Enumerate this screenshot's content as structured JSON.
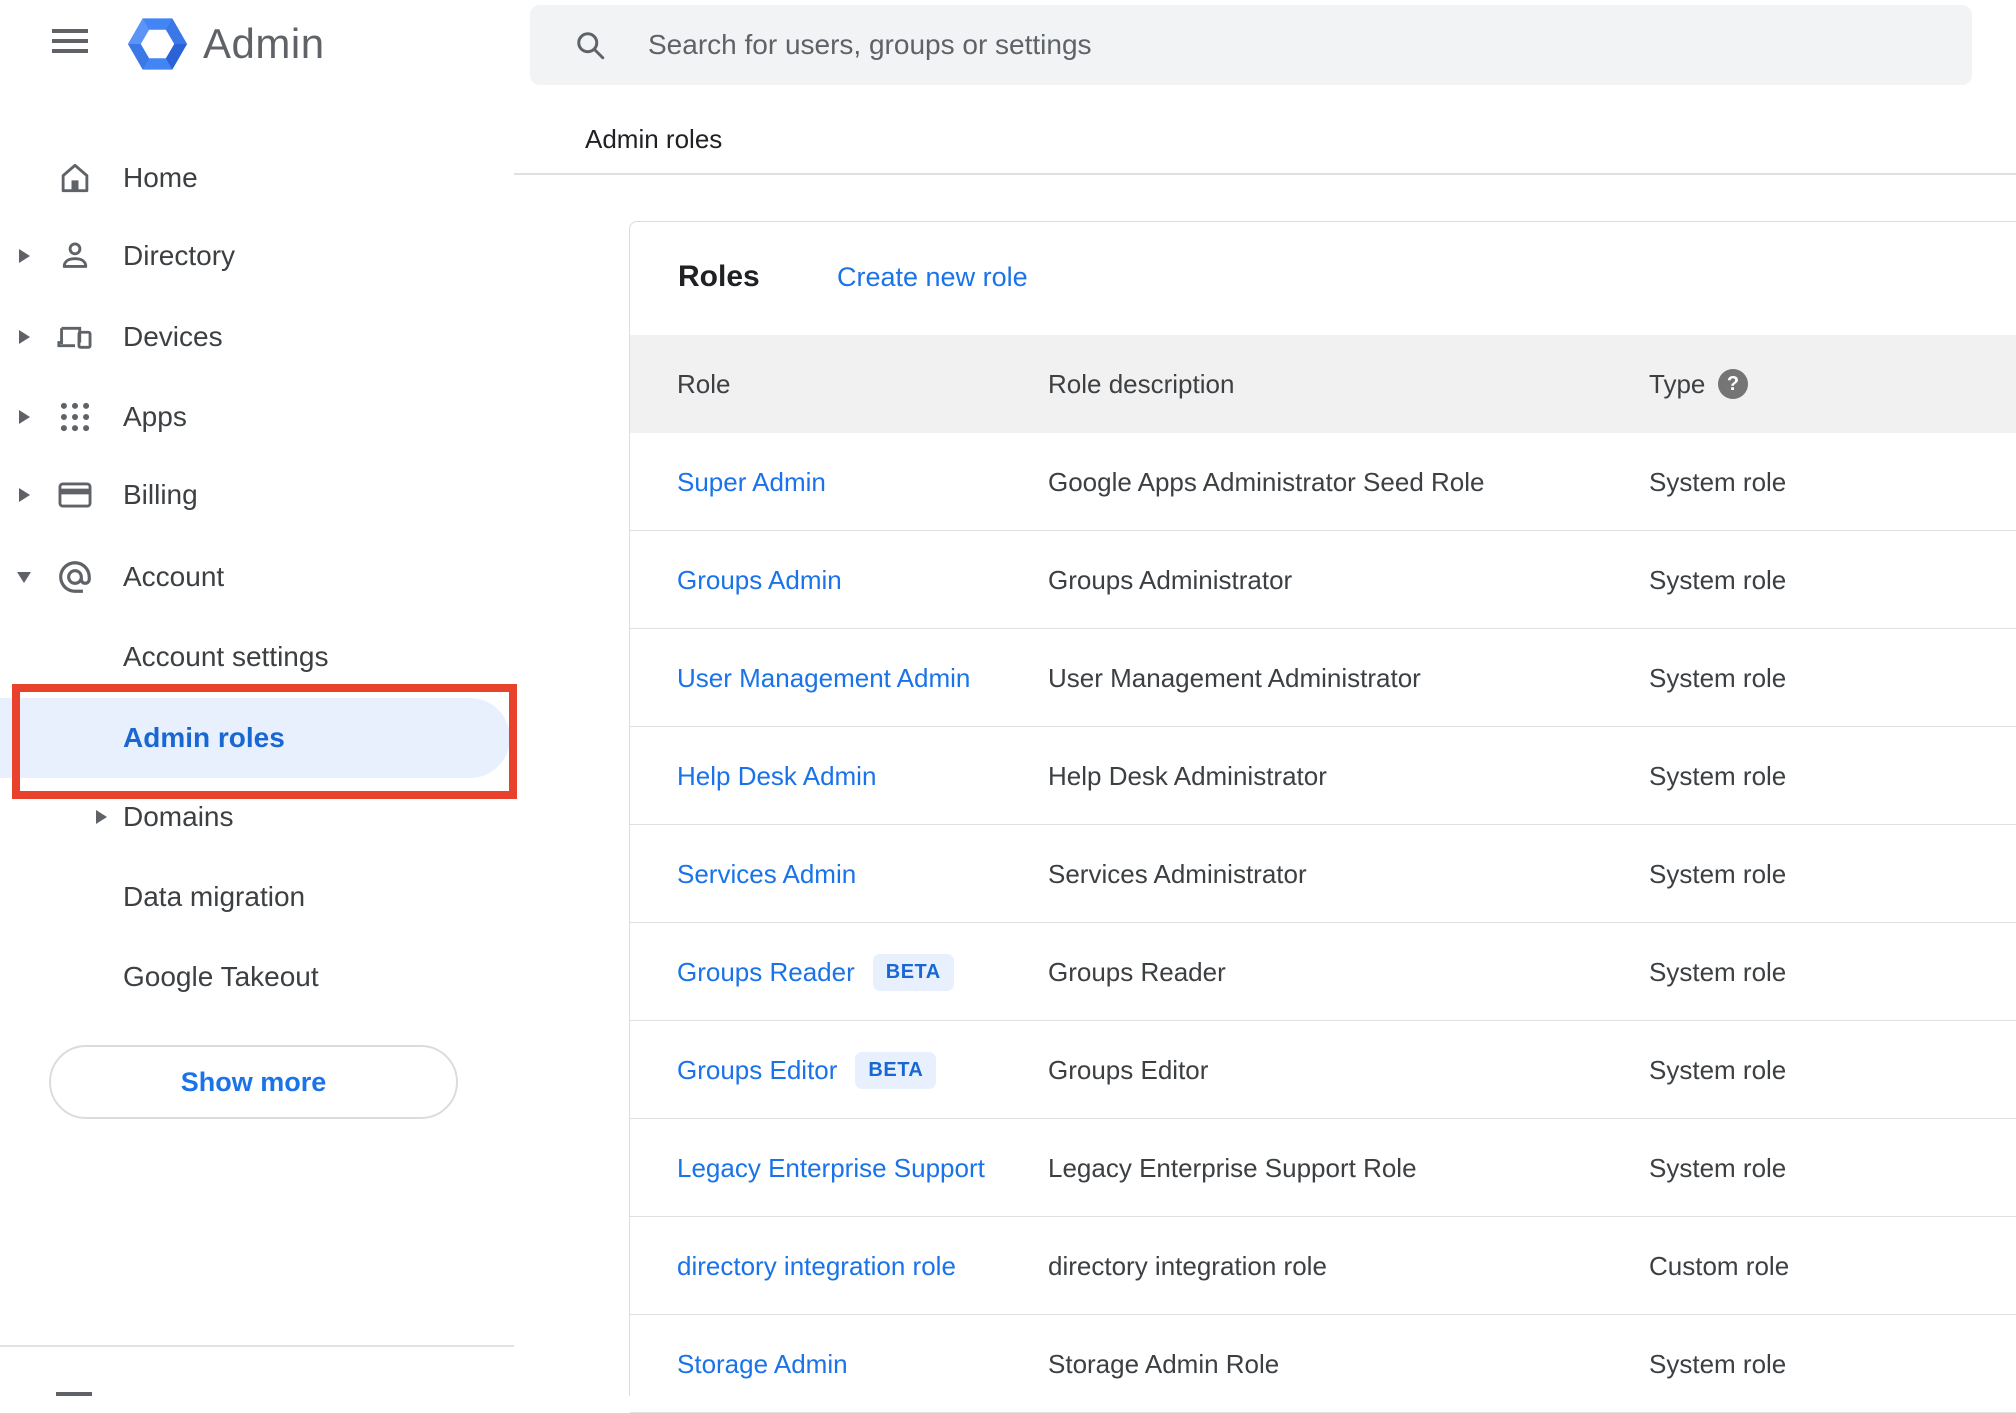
{
  "app": {
    "brand": "Admin"
  },
  "search": {
    "placeholder": "Search for users, groups or settings"
  },
  "breadcrumb": "Admin roles",
  "sidebar": {
    "items": [
      {
        "label": "Home"
      },
      {
        "label": "Directory"
      },
      {
        "label": "Devices"
      },
      {
        "label": "Apps"
      },
      {
        "label": "Billing"
      },
      {
        "label": "Account"
      },
      {
        "label": "Account settings"
      },
      {
        "label": "Admin roles"
      },
      {
        "label": "Domains"
      },
      {
        "label": "Data migration"
      },
      {
        "label": "Google Takeout"
      }
    ],
    "show_more_label": "Show more"
  },
  "roles_panel": {
    "title": "Roles",
    "create_link": "Create new role",
    "beta_label": "BETA",
    "columns": {
      "role": "Role",
      "description": "Role description",
      "type": "Type"
    },
    "rows": [
      {
        "role": "Super Admin",
        "beta": false,
        "description": "Google Apps Administrator Seed Role",
        "type": "System role"
      },
      {
        "role": "Groups Admin",
        "beta": false,
        "description": "Groups Administrator",
        "type": "System role"
      },
      {
        "role": "User Management Admin",
        "beta": false,
        "description": "User Management Administrator",
        "type": "System role"
      },
      {
        "role": "Help Desk Admin",
        "beta": false,
        "description": "Help Desk Administrator",
        "type": "System role"
      },
      {
        "role": "Services Admin",
        "beta": false,
        "description": "Services Administrator",
        "type": "System role"
      },
      {
        "role": "Groups Reader",
        "beta": true,
        "description": "Groups Reader",
        "type": "System role"
      },
      {
        "role": "Groups Editor",
        "beta": true,
        "description": "Groups Editor",
        "type": "System role"
      },
      {
        "role": "Legacy Enterprise Support",
        "beta": false,
        "description": "Legacy Enterprise Support Role",
        "type": "System role"
      },
      {
        "role": "directory integration role",
        "beta": false,
        "description": "directory integration role",
        "type": "Custom role"
      },
      {
        "role": "Storage Admin",
        "beta": false,
        "description": "Storage Admin Role",
        "type": "System role"
      }
    ]
  },
  "colors": {
    "link_blue": "#1a73e8",
    "selected_text_blue": "#1967d2",
    "selected_bg": "#e8f0fe",
    "annotation_red": "#e8412c",
    "beta_bg": "#e8f0fe",
    "beta_text": "#1967d2",
    "table_header_bg": "#f1f1f1",
    "search_bg": "#f1f3f4",
    "icon_gray": "#5f6368",
    "text_dark": "#3c4043",
    "divider": "#e0e0e0",
    "logo_blue": "#4285f4"
  }
}
